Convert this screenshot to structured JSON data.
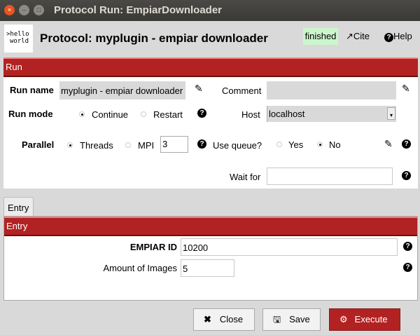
{
  "window": {
    "title": "Protocol Run: EmpiarDownloader",
    "close": "×",
    "minimize": "–",
    "maximize": "□"
  },
  "header": {
    "logo_text": ">hello\nworld",
    "logo_line1": ">hello",
    "logo_line2": "world",
    "title": "Protocol: myplugin - empiar downloader",
    "status": "finished",
    "status_color": "#ccf5cc",
    "cite": "Cite",
    "help": "Help"
  },
  "run": {
    "section": "Run",
    "run_name_label": "Run name",
    "run_name_value": "myplugin - empiar downloader",
    "comment_label": "Comment",
    "comment_value": "",
    "run_mode_label": "Run mode",
    "run_mode_options": [
      "Continue",
      "Restart"
    ],
    "run_mode_selected": "Continue",
    "host_label": "Host",
    "host_value": "localhost",
    "parallel_label": "Parallel",
    "parallel_options": [
      "Threads",
      "MPI"
    ],
    "parallel_selected": "Threads",
    "threads_value": "3",
    "use_queue_label": "Use queue?",
    "queue_options": [
      "Yes",
      "No"
    ],
    "queue_selected": "No",
    "wait_for_label": "Wait for",
    "wait_for_value": ""
  },
  "tabs": [
    {
      "label": "Entry",
      "active": true
    }
  ],
  "entry": {
    "section": "Entry",
    "empiar_id_label": "EMPIAR ID",
    "empiar_id_value": "10200",
    "amount_label": "Amount of Images",
    "amount_value": "5"
  },
  "buttons": {
    "close": "Close",
    "save": "Save",
    "execute": "Execute"
  },
  "colors": {
    "accent": "#b22222"
  }
}
